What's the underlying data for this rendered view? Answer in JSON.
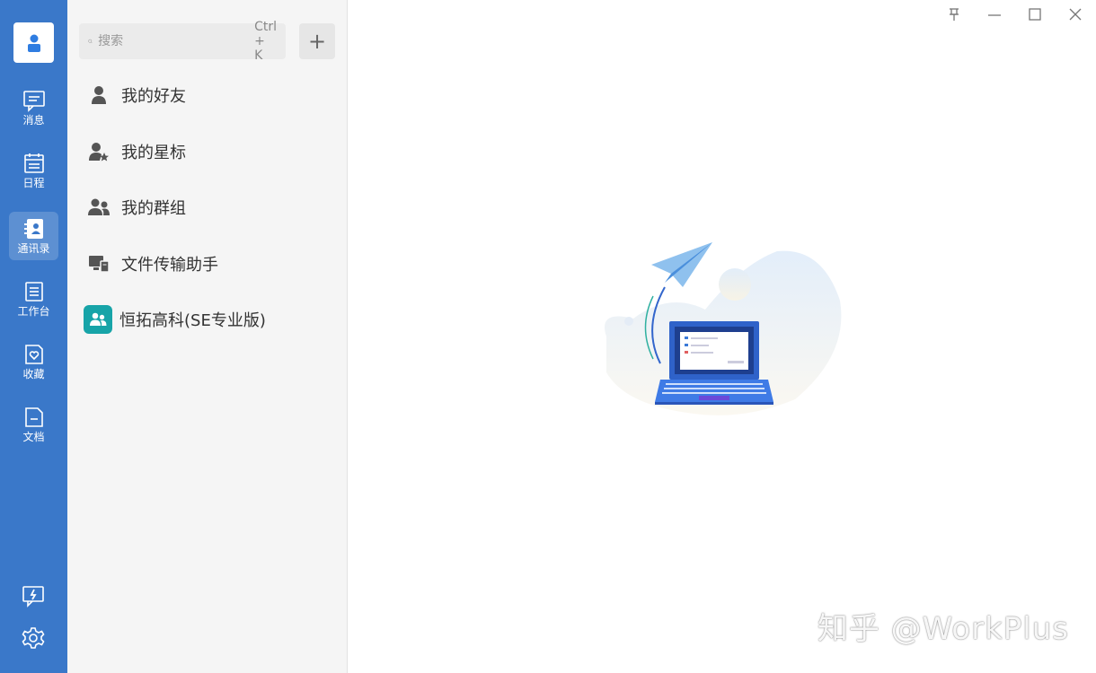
{
  "rail": {
    "items": [
      {
        "label": "消息",
        "icon": "message-icon"
      },
      {
        "label": "日程",
        "icon": "calendar-icon"
      },
      {
        "label": "通讯录",
        "icon": "contacts-icon"
      },
      {
        "label": "工作台",
        "icon": "workbench-icon"
      },
      {
        "label": "收藏",
        "icon": "favorites-icon"
      },
      {
        "label": "文档",
        "icon": "document-icon"
      }
    ],
    "active_index": 2,
    "accent_color": "#3a78c9"
  },
  "search": {
    "placeholder": "搜索",
    "shortcut": "Ctrl + K"
  },
  "add_button": "+",
  "contacts": [
    {
      "label": "我的好友",
      "icon": "person-icon"
    },
    {
      "label": "我的星标",
      "icon": "starred-person-icon"
    },
    {
      "label": "我的群组",
      "icon": "group-icon"
    },
    {
      "label": "文件传输助手",
      "icon": "file-transfer-icon"
    },
    {
      "label": "恒拓高科(SE专业版)",
      "icon": "organization-icon"
    }
  ],
  "watermark": "知乎 @WorkPlus"
}
